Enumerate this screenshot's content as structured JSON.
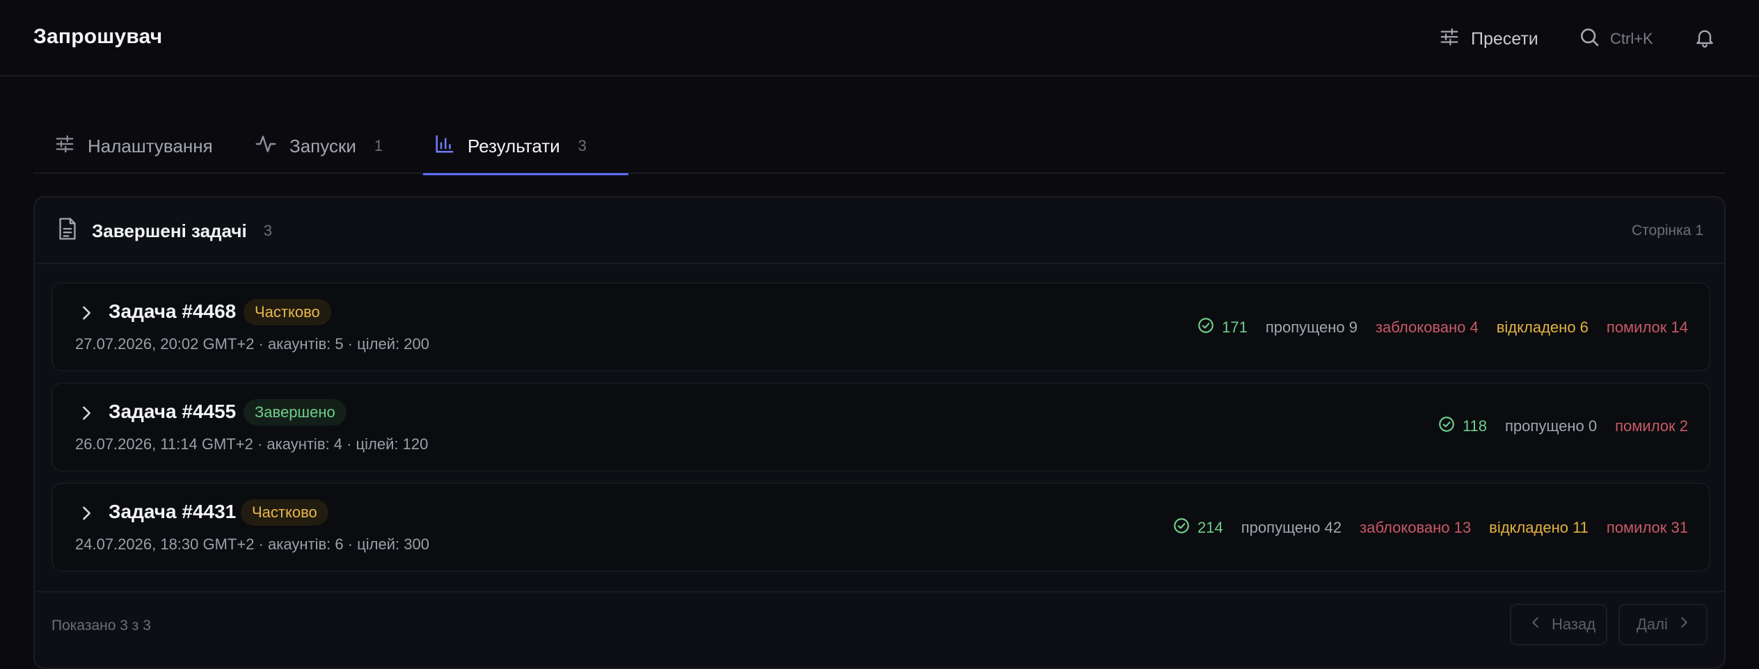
{
  "app": {
    "title": "Запрошувач"
  },
  "header": {
    "presets_label": "Пресети",
    "search_shortcut": "Ctrl+K"
  },
  "tabs": [
    {
      "label": "Налаштування",
      "count": ""
    },
    {
      "label": "Запуски",
      "count": "1"
    },
    {
      "label": "Результати",
      "count": "3"
    }
  ],
  "panel": {
    "title": "Завершені задачі",
    "count": "3",
    "page_label": "Сторінка 1"
  },
  "tasks": [
    {
      "name": "Задача #4468",
      "status": "Частково",
      "meta": "27.07.2026, 20:02 GMT+2 · акаунтів: 5 · цілей: 200",
      "success": "171",
      "skipped": "пропущено 9",
      "blocked": "заблоковано 4",
      "delayed": "відкладено 6",
      "errors": "помилок 14"
    },
    {
      "name": "Задача #4455",
      "status": "Завершено",
      "meta": "26.07.2026, 11:14 GMT+2 · акаунтів: 4 · цілей: 120",
      "success": "118",
      "skipped": "пропущено 0",
      "errors": "помилок 2"
    },
    {
      "name": "Задача #4431",
      "status": "Частково",
      "meta": "24.07.2026, 18:30 GMT+2 · акаунтів: 6 · цілей: 300",
      "success": "214",
      "skipped": "пропущено 42",
      "blocked": "заблоковано 13",
      "delayed": "відкладено 11",
      "errors": "помилок 31"
    }
  ],
  "footer": {
    "shown": "Показано 3 з 3",
    "prev_label": "Назад",
    "next_label": "Далі"
  },
  "colors": {
    "background": "#0b0b0f",
    "accent": "#5b6cff",
    "success": "#6fcf8a",
    "warning": "#e3b341",
    "danger": "#c85a66"
  },
  "icons": {
    "presets": "sliders-icon",
    "search": "search-icon",
    "notifications": "bell-icon",
    "settings_tab": "sliders-icon",
    "runs_tab": "activity-icon",
    "results_tab": "bar-chart-icon",
    "panel": "document-icon",
    "expand": "chevron-right-icon",
    "success": "check-circle-icon"
  }
}
